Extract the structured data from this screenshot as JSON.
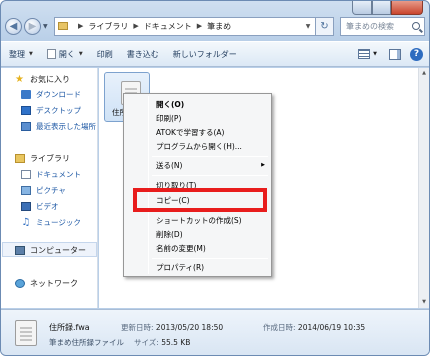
{
  "address": {
    "crumbs": [
      "ライブラリ",
      "ドキュメント",
      "筆まめ"
    ],
    "search_placeholder": "筆まめの検索"
  },
  "toolbar": {
    "organize": "整理",
    "open": "開く",
    "print": "印刷",
    "burn": "書き込む",
    "new_folder": "新しいフォルダー"
  },
  "nav": {
    "favorites": "お気に入り",
    "downloads": "ダウンロード",
    "desktop": "デスクトップ",
    "recent": "最近表示した場所",
    "libraries": "ライブラリ",
    "documents": "ドキュメント",
    "pictures": "ピクチャ",
    "videos": "ビデオ",
    "music": "ミュージック",
    "computer": "コンピューター",
    "network": "ネットワーク"
  },
  "file": {
    "label": "住所録.fwa"
  },
  "context_menu": {
    "items": [
      "開く(O)",
      "印刷(P)",
      "ATOKで学習する(A)",
      "プログラムから開く(H)...",
      "送る(N)",
      "切り取り(T)",
      "コピー(C)",
      "ショートカットの作成(S)",
      "削除(D)",
      "名前の変更(M)",
      "プロパティ(R)"
    ]
  },
  "details": {
    "name": "住所録.fwa",
    "type": "筆まめ住所録ファイル",
    "modified_label": "更新日時:",
    "modified_value": "2013/05/20 18:50",
    "created_label": "作成日時:",
    "created_value": "2014/06/19 10:35",
    "size_label": "サイズ:",
    "size_value": "55.5 KB"
  },
  "colors": {
    "highlight_border": "#e81d1d",
    "window_frame": "#b9cfe8"
  }
}
